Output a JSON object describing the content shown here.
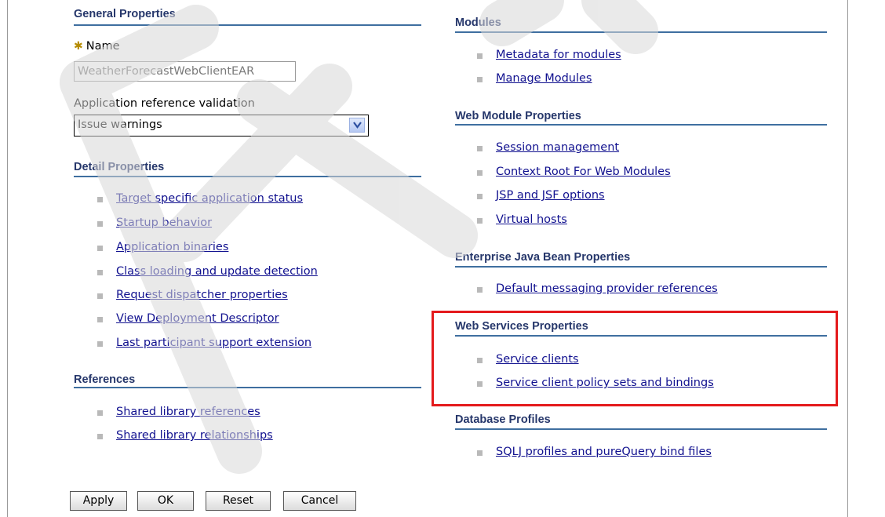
{
  "general": {
    "title": "General Properties",
    "name_label": "Name",
    "name_value": "WeatherForecastWebClientEAR",
    "arv_label": "Application reference validation",
    "arv_selected": "Issue warnings"
  },
  "detail": {
    "title": "Detail Properties",
    "links": [
      "Target specific application status",
      "Startup behavior",
      "Application binaries",
      "Class loading and update detection",
      "Request dispatcher properties",
      "View Deployment Descriptor",
      "Last participant support extension"
    ]
  },
  "references": {
    "title": "References",
    "links": [
      "Shared library references",
      "Shared library relationships"
    ]
  },
  "modules": {
    "title": "Modules",
    "links": [
      "Metadata for modules",
      "Manage Modules"
    ]
  },
  "web_module": {
    "title": "Web Module Properties",
    "links": [
      "Session management",
      "Context Root For Web Modules",
      "JSP and JSF options",
      "Virtual hosts"
    ]
  },
  "ejb": {
    "title": "Enterprise Java Bean Properties",
    "links": [
      "Default messaging provider references"
    ]
  },
  "web_services": {
    "title": "Web Services Properties",
    "links": [
      "Service clients",
      "Service client policy sets and bindings"
    ]
  },
  "database": {
    "title": "Database Profiles",
    "links": [
      "SQLJ profiles and pureQuery bind files"
    ]
  },
  "buttons": {
    "apply": "Apply",
    "ok": "OK",
    "reset": "Reset",
    "cancel": "Cancel"
  },
  "colors": {
    "section_title": "#26376b",
    "rule": "#3f6fa0",
    "link": "#11118f",
    "highlight_box": "#e41a1c"
  }
}
